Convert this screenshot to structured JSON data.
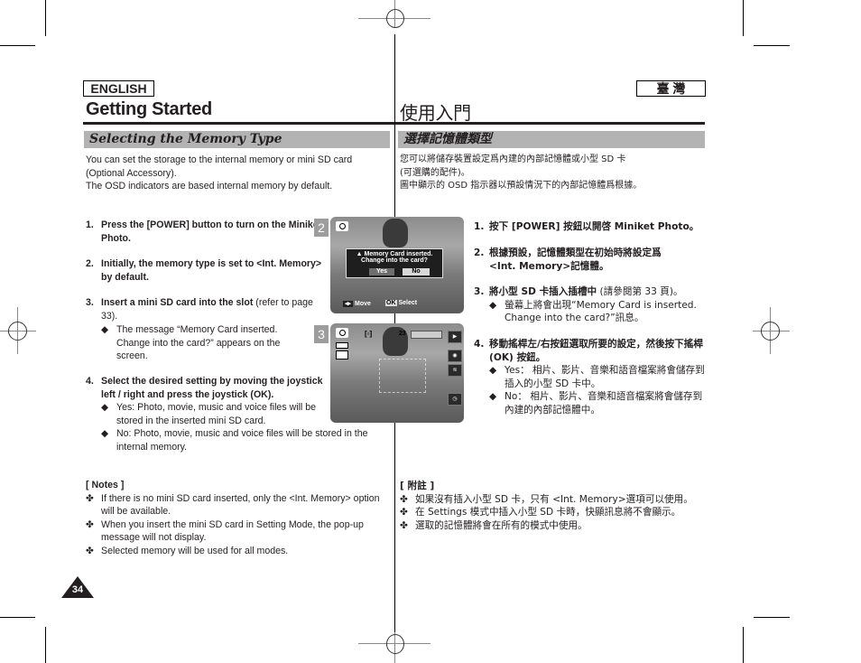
{
  "header": {
    "lang_left": "ENGLISH",
    "lang_right": "臺 灣",
    "title_left": "Getting Started",
    "title_right": "使用入門"
  },
  "section": {
    "title_en": "Selecting the Memory Type",
    "title_zh": "選擇記憶體類型"
  },
  "intro_en": [
    "You can set the storage to the internal memory or mini SD card",
    "(Optional Accessory).",
    "The OSD indicators are based internal memory by default."
  ],
  "intro_zh": [
    "您可以將儲存裝置設定爲內建的內部記憶體或小型 SD 卡",
    "(可選購的配件)。",
    "圖中顯示的 OSD 指示器以預設情況下的內部記憶體爲根據。"
  ],
  "steps_en": [
    {
      "num": "1.",
      "bold": "Press the [POWER] button to turn on the Miniket Photo.",
      "normal": "",
      "bullets": []
    },
    {
      "num": "2.",
      "bold": "Initially, the memory type is set to <Int. Memory> by default.",
      "normal": "",
      "bullets": []
    },
    {
      "num": "3.",
      "bold": "Insert a mini SD card into the slot",
      "normal": " (refer to page 33).",
      "bullets": [
        "The message “Memory Card inserted. Change into the card?” appears on the screen."
      ]
    },
    {
      "num": "4.",
      "bold": "Select the desired setting by moving the joystick left / right and press the joystick (OK).",
      "normal": "",
      "bullets": [
        "Yes: Photo, movie, music and voice files will be stored in the inserted mini SD card.",
        "No: Photo, movie, music and voice files will be stored in the internal memory."
      ]
    }
  ],
  "steps_zh": [
    {
      "num": "1.",
      "bold": "按下 [POWER] 按鈕以開啓 Miniket Photo。",
      "normal": "",
      "bullets": []
    },
    {
      "num": "2.",
      "bold": "根據預設，記憶體類型在初始時將設定爲 <Int. Memory>記憶體。",
      "normal": "",
      "bullets": []
    },
    {
      "num": "3.",
      "bold": "將小型 SD 卡插入插槽中",
      "normal": " (請參閱第 33 頁)。",
      "bullets": [
        "螢幕上將會出現“Memory Card is inserted. Change into the card?”訊息。"
      ]
    },
    {
      "num": "4.",
      "bold": "移動搖桿左/右按鈕選取所要的設定，然後按下搖桿 (OK) 按鈕。",
      "normal": "",
      "bullets": [
        "Yes： 相片、影片、音樂和語音檔案將會儲存到插入的小型 SD 卡中。",
        "No： 相片、影片、音樂和語音檔案將會儲存到內建的內部記憶體中。"
      ]
    }
  ],
  "bullet_symbol": "◆",
  "note_symbol": "✤",
  "notes_en": {
    "title": "[ Notes ]",
    "items": [
      "If there is no mini SD card inserted, only the <Int. Memory> option will be available.",
      "When you insert the mini SD card in Setting Mode, the pop-up message will not display.",
      "Selected memory will be used for all modes."
    ]
  },
  "notes_zh": {
    "title": "[ 附註 ]",
    "items": [
      "如果沒有插入小型 SD 卡，只有 <Int. Memory>選項可以使用。",
      "在 Settings 模式中插入小型 SD 卡時，快顯訊息將不會顯示。",
      "選取的記憶體將會在所有的模式中使用。"
    ]
  },
  "screenshots": [
    {
      "num": "2",
      "dialog_line1": "Memory Card inserted.",
      "dialog_line2": "Change into the card?",
      "yes": "Yes",
      "no": "No",
      "hint_move": "Move",
      "hint_ok": "OK",
      "hint_select": "Select"
    },
    {
      "num": "3",
      "counter": "23",
      "focus": "[▫]"
    }
  ],
  "page_number": "34",
  "colors": {
    "section_bar": "#b3b3b3",
    "text": "#231f20",
    "shot_badge": "#9d9d9d"
  }
}
